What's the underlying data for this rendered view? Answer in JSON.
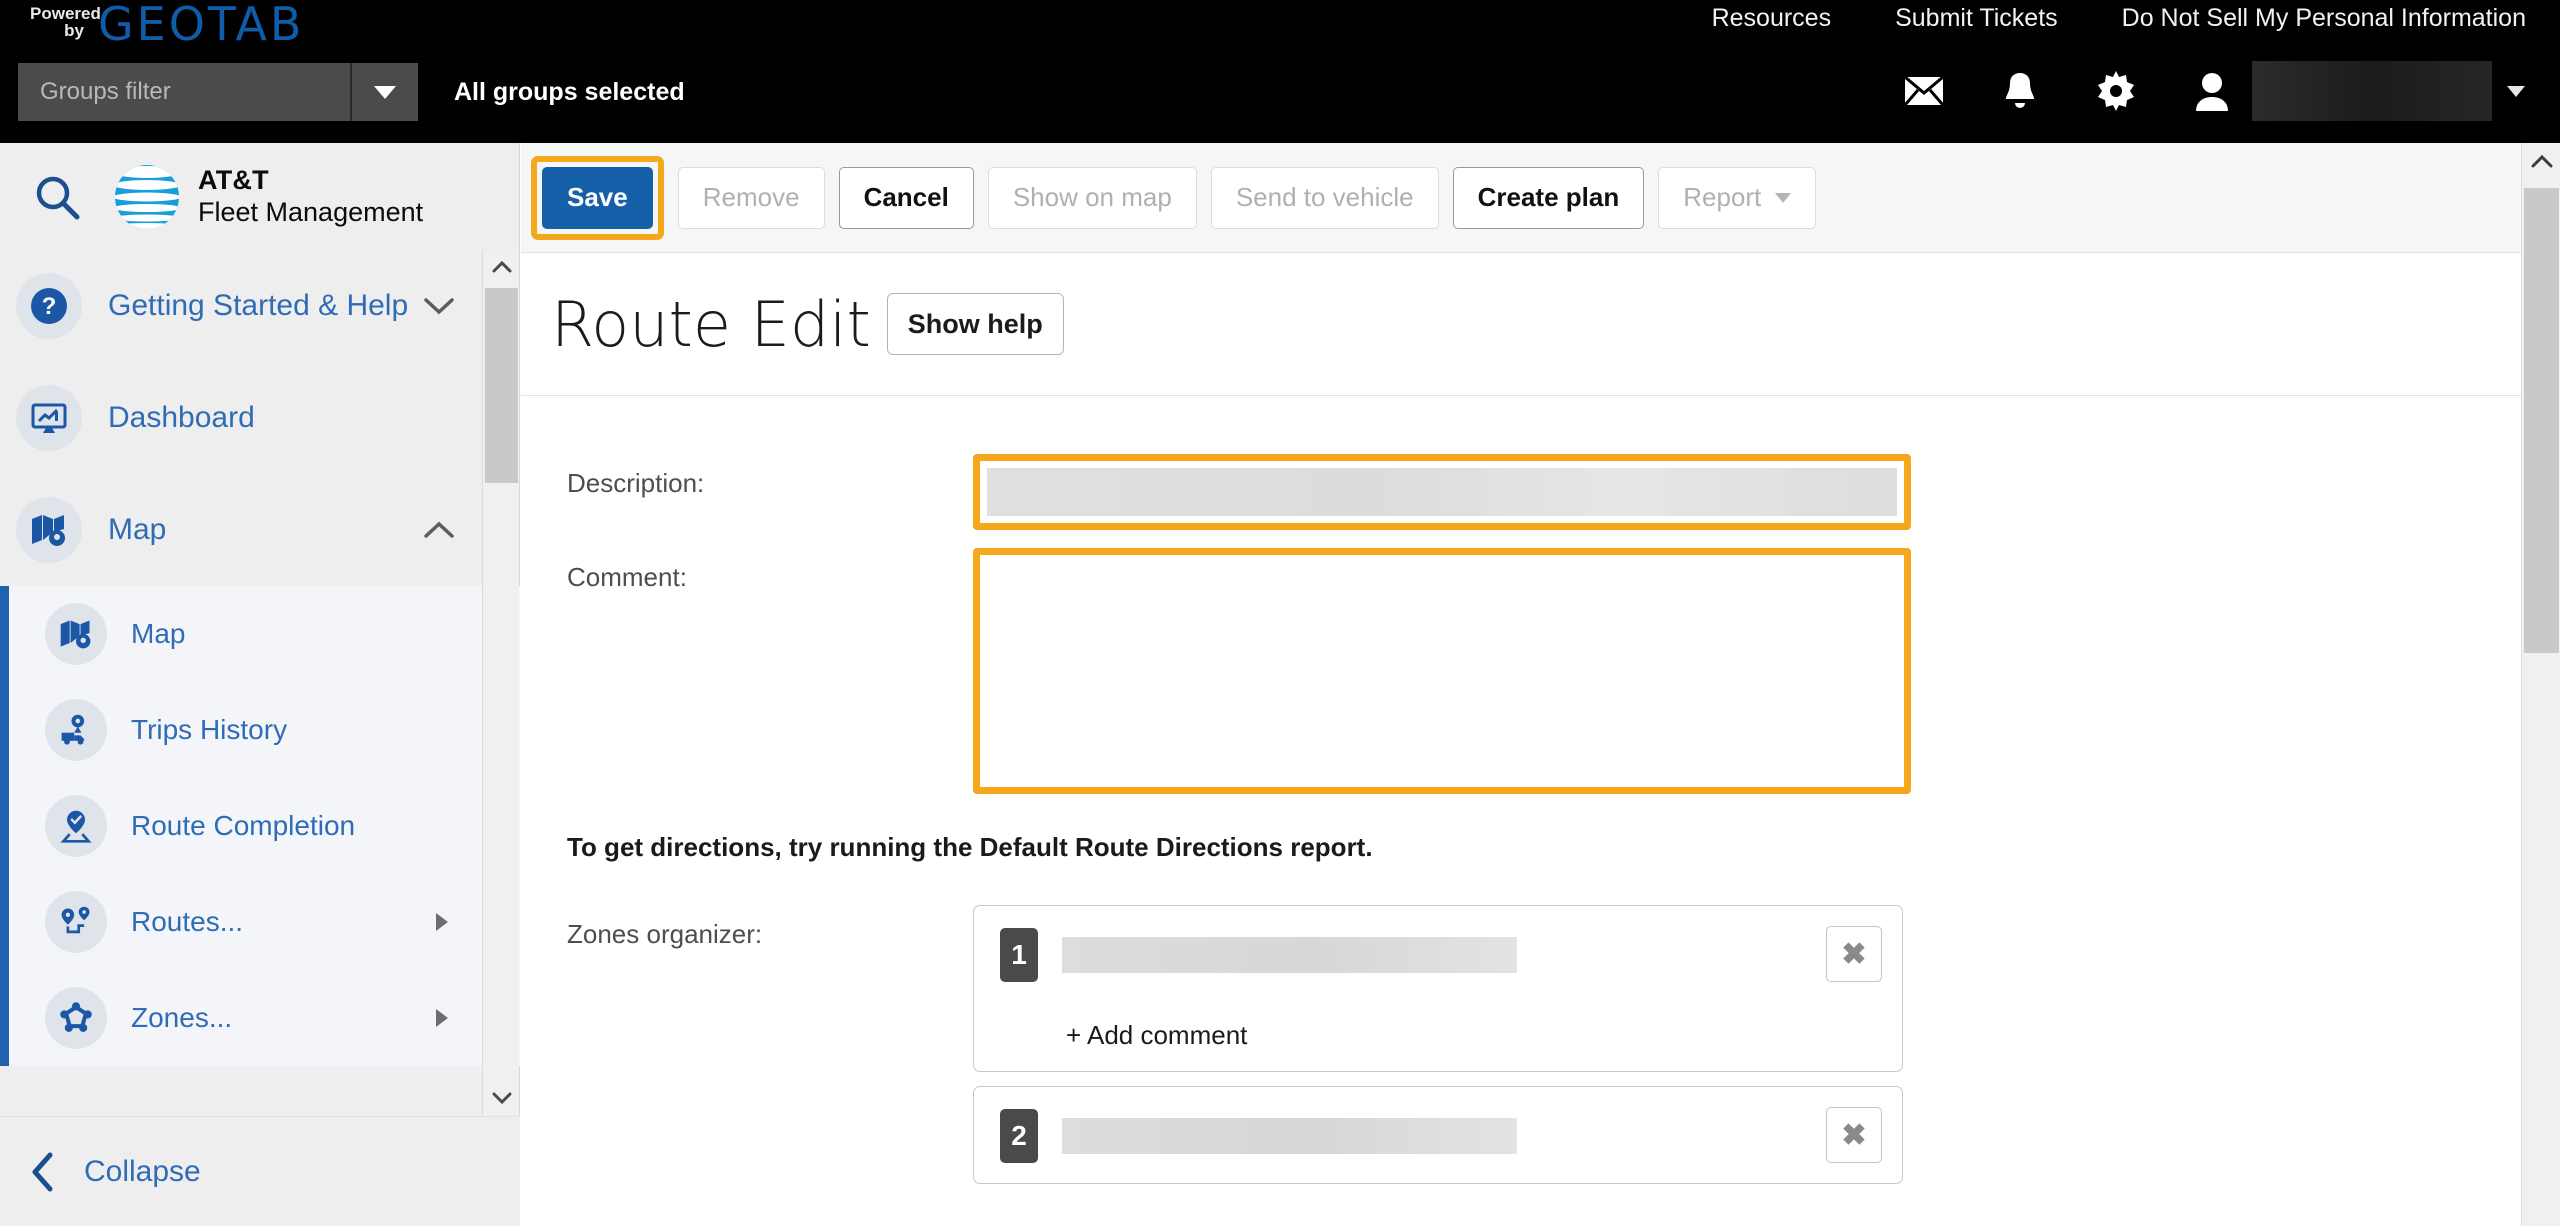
{
  "topbar": {
    "powered": "Powered",
    "by": "by",
    "brand": "GEOTAB",
    "nav": [
      {
        "label": "Resources"
      },
      {
        "label": "Submit Tickets"
      },
      {
        "label": "Do Not Sell My Personal Information"
      }
    ],
    "groups_filter_placeholder": "Groups filter",
    "groups_status": "All groups selected",
    "icons": [
      "mail-icon",
      "bell-icon",
      "gear-icon",
      "user-icon"
    ],
    "user_name": ""
  },
  "sidebar": {
    "search_icon": "search-icon",
    "brand_line1": "AT&T",
    "brand_line2": "Fleet Management",
    "items": [
      {
        "label": "Getting Started & Help",
        "icon": "help-circle-icon",
        "chevron": "down"
      },
      {
        "label": "Dashboard",
        "icon": "dashboard-icon",
        "chevron": "none"
      },
      {
        "label": "Map",
        "icon": "map-icon",
        "chevron": "up"
      }
    ],
    "submenu": [
      {
        "label": "Map",
        "icon": "map-icon",
        "arrow": false
      },
      {
        "label": "Trips History",
        "icon": "trips-history-icon",
        "arrow": false
      },
      {
        "label": "Route Completion",
        "icon": "route-completion-icon",
        "arrow": false
      },
      {
        "label": "Routes...",
        "icon": "routes-icon",
        "arrow": true
      },
      {
        "label": "Zones...",
        "icon": "zones-icon",
        "arrow": true
      }
    ],
    "collapse_label": "Collapse"
  },
  "toolbar": {
    "save_label": "Save",
    "remove_label": "Remove",
    "cancel_label": "Cancel",
    "show_on_map_label": "Show on map",
    "send_to_vehicle_label": "Send to vehicle",
    "create_plan_label": "Create plan",
    "report_label": "Report"
  },
  "page": {
    "title": "Route Edit",
    "show_help_label": "Show help",
    "description_label": "Description:",
    "description_value": "",
    "comment_label": "Comment:",
    "comment_value": "",
    "hint": "To get directions, try running the Default Route Directions report.",
    "zones_label": "Zones organizer:",
    "zones": [
      {
        "num": "1",
        "name": "",
        "add_comment_label": "+ Add comment",
        "remove_icon": "close-icon"
      },
      {
        "num": "2",
        "name": "",
        "remove_icon": "close-icon"
      }
    ]
  },
  "colors": {
    "accent_orange": "#f5a81c",
    "primary_blue": "#1560a8",
    "link_blue": "#2f6cb5",
    "topbar_black": "#000000"
  }
}
